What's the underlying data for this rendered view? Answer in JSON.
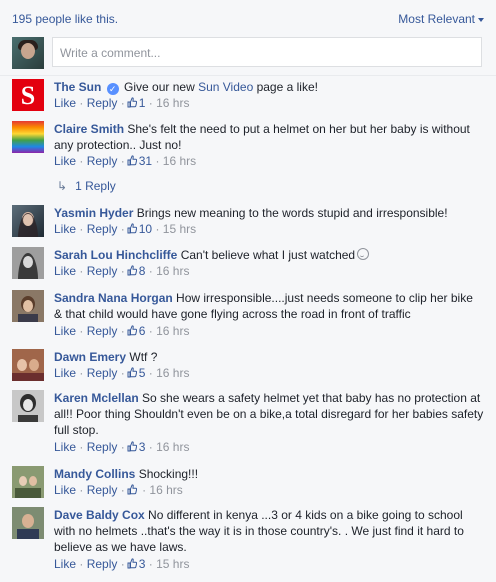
{
  "header": {
    "likes_text": "195 people like this.",
    "sort_label": "Most Relevant"
  },
  "composer": {
    "placeholder": "Write a comment..."
  },
  "actions": {
    "like": "Like",
    "reply": "Reply",
    "dot": "·"
  },
  "comments": [
    {
      "author": "The Sun",
      "verified": true,
      "text_before": "Give our new ",
      "link": "Sun Video",
      "text_after": " page a like!",
      "likes": "1",
      "time": "16 hrs"
    },
    {
      "author": "Claire Smith",
      "text": "She's felt the need to put a helmet on her but her baby is without any protection.. Just no!",
      "likes": "31",
      "time": "16 hrs",
      "replies_label": "1 Reply"
    },
    {
      "author": "Yasmin Hyder",
      "text": "Brings new meaning to the words stupid and irresponsible!",
      "likes": "10",
      "time": "15 hrs"
    },
    {
      "author": "Sarah Lou Hinchcliffe",
      "text": "Can't believe what I just watched",
      "likes": "8",
      "time": "16 hrs"
    },
    {
      "author": "Sandra Nana Horgan",
      "text": "How irresponsible....just needs someone to clip her bike & that child would have gone flying across the road in front of traffic",
      "likes": "6",
      "time": "16 hrs"
    },
    {
      "author": "Dawn Emery",
      "text": "Wtf ?",
      "likes": "5",
      "time": "16 hrs"
    },
    {
      "author": "Karen Mclellan",
      "text": "So she wears a safety helmet yet that baby has no protection at all!! Poor thing Shouldn't even be on a bike,a total disregard for her babies safety full stop.",
      "likes": "3",
      "time": "16 hrs"
    },
    {
      "author": "Mandy Collins",
      "text": "Shocking!!!",
      "likes": "",
      "time": "16 hrs"
    },
    {
      "author": "Dave Baldy Cox",
      "text": "No different in kenya ...3 or 4 kids on a bike going to school with no helmets ..that's the way it is in those country's. . We just find it hard to believe as we have laws.",
      "likes": "3",
      "time": "15 hrs"
    }
  ]
}
